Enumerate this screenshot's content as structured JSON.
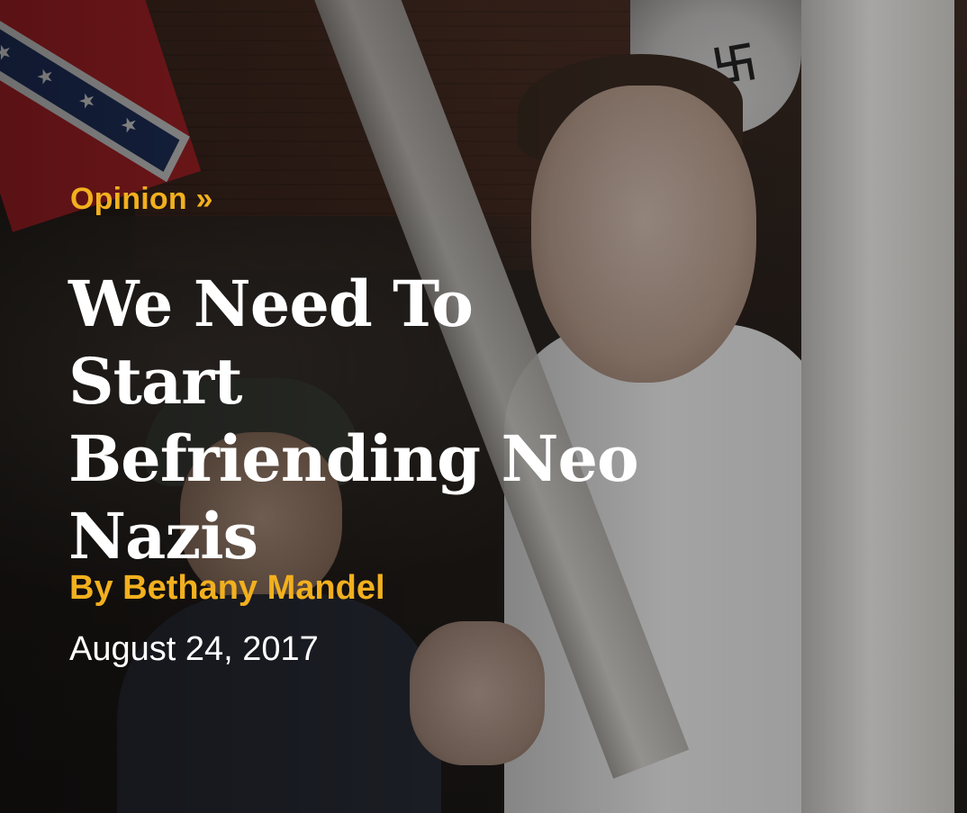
{
  "article": {
    "category": "Opinion »",
    "title": "We Need To Start Befriending Neo Nazis",
    "byline": "By Bethany Mandel",
    "date": "August 24, 2017"
  },
  "colors": {
    "accent": "#f2b01e",
    "text": "#ffffff"
  },
  "icons": {
    "flag": "confederate-flag-icon"
  }
}
